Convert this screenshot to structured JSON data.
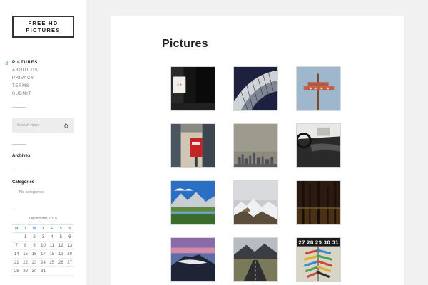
{
  "site": {
    "title_line1": "FREE HD",
    "title_line2": "PICTURES"
  },
  "nav": {
    "active_marker": "3",
    "items": [
      {
        "label": "PICTURES",
        "active": true
      },
      {
        "label": "ABOUT US",
        "active": false
      },
      {
        "label": "PRIVACY",
        "active": false
      },
      {
        "label": "TERMS",
        "active": false
      },
      {
        "label": "SUBMIT",
        "active": false
      }
    ]
  },
  "search": {
    "placeholder": "Search form",
    "icon": "search-icon"
  },
  "widgets": {
    "archives_title": "Archives",
    "categories_title": "Categories",
    "no_categories": "No categories"
  },
  "calendar": {
    "caption": "December 2015",
    "days": [
      "M",
      "T",
      "W",
      "T",
      "F",
      "S",
      "S"
    ],
    "weeks": [
      [
        "",
        "1",
        "2",
        "3",
        "4",
        "5",
        "6"
      ],
      [
        "7",
        "8",
        "9",
        "10",
        "11",
        "12",
        "13"
      ],
      [
        "14",
        "15",
        "16",
        "17",
        "18",
        "19",
        "20"
      ],
      [
        "21",
        "22",
        "23",
        "24",
        "25",
        "26",
        "27"
      ],
      [
        "28",
        "29",
        "30",
        "31",
        "",
        "",
        ""
      ]
    ]
  },
  "main": {
    "title": "Pictures"
  },
  "pictures": [
    {
      "name": "vending-sign-photo"
    },
    {
      "name": "curved-architecture-photo"
    },
    {
      "name": "street-sign-pole-photo"
    },
    {
      "name": "red-mailbox-photo"
    },
    {
      "name": "hazy-city-skyline-photo"
    },
    {
      "name": "car-interior-photo"
    },
    {
      "name": "alpine-lake-photo"
    },
    {
      "name": "snowy-mountains-photo"
    },
    {
      "name": "dark-forest-photo"
    },
    {
      "name": "volcano-sunset-photo"
    },
    {
      "name": "mountain-road-photo"
    },
    {
      "name": "colorful-arrows-photo"
    }
  ],
  "extra_text": {
    "arrows_numbers": "27 28 29 30 31"
  }
}
